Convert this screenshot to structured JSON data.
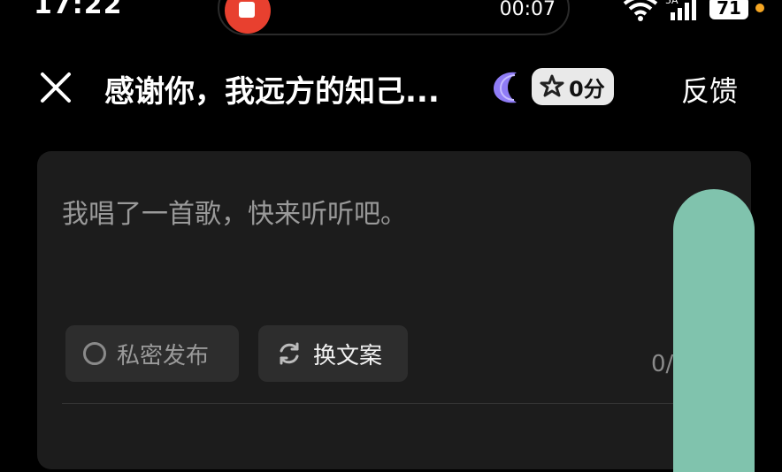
{
  "status": {
    "time": "17:22",
    "recording_timer": "00:07",
    "network": "5A",
    "battery": "71"
  },
  "header": {
    "title": "感谢你，我远方的知己...",
    "score": "0分",
    "feedback": "反馈"
  },
  "card": {
    "caption": "我唱了一首歌，快来听听吧。",
    "private_label": "私密发布",
    "switch_label": "换文案",
    "counter": "0/"
  },
  "colors": {
    "accent_green": "#80c3ad",
    "record_red": "#e8402f",
    "brand_purple": "#8f7cf6"
  }
}
